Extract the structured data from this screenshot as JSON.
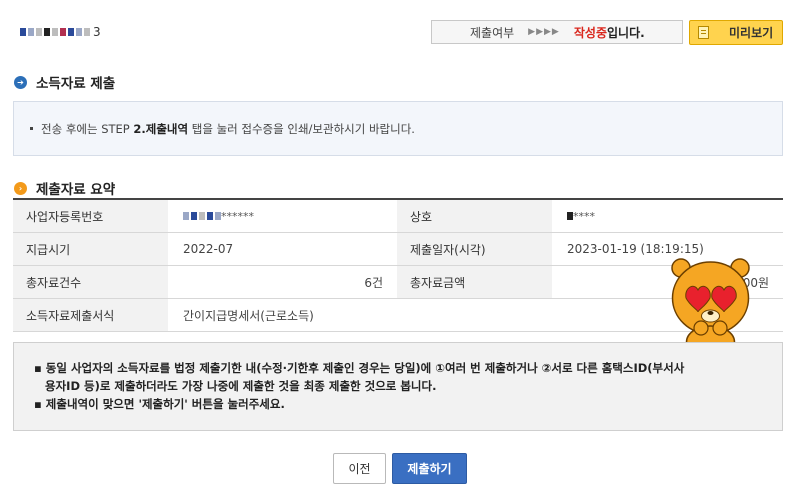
{
  "header": {
    "corp_suffix": "3",
    "status_label": "제출여부",
    "status_arrows": "▶▶▶▶",
    "status_value": "작성중",
    "status_tail": "입니다.",
    "preview_label": "미리보기"
  },
  "section1": {
    "title": "소득자료 제출",
    "notice_prefix": "전송 후에는 STEP ",
    "notice_bold": "2.제출내역",
    "notice_suffix": " 탭을 눌러 접수증을 인쇄/보관하시기 바랍니다."
  },
  "section2": {
    "title": "제출자료 요약",
    "rows": [
      {
        "h1": "사업자등록번호",
        "v1": "******",
        "h2": "상호",
        "v2": "****"
      },
      {
        "h1": "지급시기",
        "v1": "2022-07",
        "h2": "제출일자(시각)",
        "v2": "2023-01-19 (18:19:15)"
      },
      {
        "h1": "총자료건수",
        "v1": "6건",
        "h2": "총자료금액",
        "v2": "00원"
      },
      {
        "h1": "소득자료제출서식",
        "v1": "간이지급명세서(근로소득)",
        "h2": "",
        "v2": ""
      }
    ]
  },
  "notice2": {
    "line1": "동일 사업자의 소득자료를 법정 제출기한 내(수정·기한후 제출인 경우는 당일)에 ①여러 번 제출하거나 ②서로 다른 홈택스ID(부서사",
    "line2": "용자ID 등)로 제출하더라도 가장 나중에 제출한 것을 최종 제출한 것으로 봅니다.",
    "line3": "제출내역이 맞으면 '제출하기' 버튼을 눌러주세요."
  },
  "buttons": {
    "prev": "이전",
    "submit": "제출하기"
  },
  "colors": {
    "status_red": "#d9261c",
    "preview_yellow": "#ffd34e",
    "submit_blue": "#3a6fc2",
    "title_icon_blue": "#2c6fb8",
    "title_icon_orange": "#f39a1b"
  }
}
